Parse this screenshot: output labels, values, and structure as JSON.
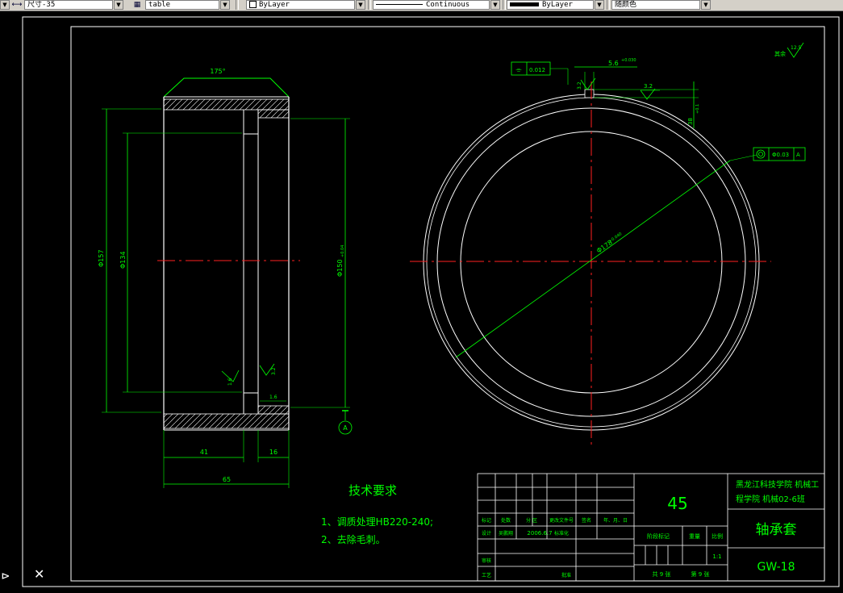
{
  "toolbar": {
    "dimstyle": "尺寸-35",
    "tablestyle": "table",
    "color": "ByLayer",
    "linetype": "Continuous",
    "lineweight": "ByLayer",
    "plotstyle": "随颜色"
  },
  "drawing": {
    "dims": {
      "top_angle": "175°",
      "phi157": "Φ157",
      "phi134": "Φ134",
      "phi150": "Φ150",
      "phi150_tol": "+0.04",
      "d41": "41",
      "d16": "16",
      "d65": "65",
      "rough_16a": "1.6",
      "rough_32a": "3.2",
      "rough_16b": "1.6",
      "rough_32b": "3.2",
      "rough_32c": "3.2",
      "d56": "5.6",
      "d56_tol": "+0.030",
      "d38": "38",
      "d38_tol": "+0.1",
      "phi178": "Φ178",
      "phi178_tol": "+0.040",
      "flatness_sym": "⌯",
      "flatness_val": "0.012",
      "concentric_val": "Φ0.03",
      "datum_ref": "A",
      "datum_label": "A",
      "other_rough_label": "其余",
      "other_rough_val": "12.5"
    },
    "tech": {
      "title": "技术要求",
      "line1": "1、调质处理HB220-240;",
      "line2": "2、去除毛刺。"
    },
    "title_block": {
      "material": "45",
      "school_line1": "黑龙江科技学院 机械工",
      "school_line2": "程学院 机械02-6班",
      "part_name": "轴承套",
      "drawing_no": "GW-18",
      "scale": "1:1",
      "h_mark": "标记",
      "h_count": "处数",
      "h_zone": "分 区",
      "h_docno": "更改文件号",
      "h_sign": "签名",
      "h_date": "年、月、日",
      "r_design": "设计",
      "r_name": "吴鹏翔",
      "r_date": "2006.6.7",
      "r_std": "标准化",
      "stage_label": "阶段标记",
      "weight_label": "重量",
      "scale_label": "比例",
      "review": "审核",
      "process": "工艺",
      "approve": "批准",
      "sheets": "共 9 张",
      "sheet": "第 9 张"
    }
  }
}
